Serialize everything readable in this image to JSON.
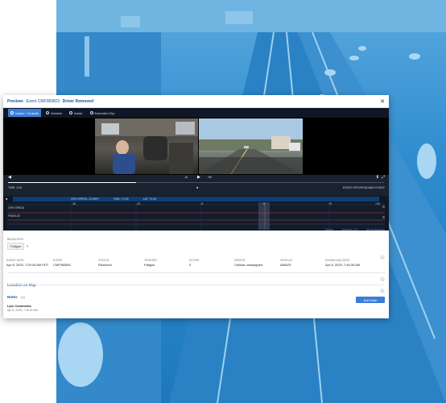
{
  "header": {
    "preview_label": "Preview:",
    "event_id": "Event CMF083801:",
    "event_status": "Driver Removed",
    "close_icon": "close-icon"
  },
  "tabs": [
    {
      "label": "Inside + Outside",
      "active": true
    },
    {
      "label": "Outside",
      "active": false
    },
    {
      "label": "Inside",
      "active": false
    },
    {
      "label": "Extended Clip",
      "active": false
    }
  ],
  "player": {
    "rewind_label": "-5",
    "forward_label": "+5",
    "progress_fraction": 0.34,
    "time_label": "TIME: 4.00",
    "event_time_label": "EVENT INFO/ROADWAY EVENT"
  },
  "telemetry": {
    "speed": "GPS SPEED: 23 MPH",
    "fwd": "FWD: +0.00",
    "lat": "LAT: +0.00",
    "row1": "GPS SPEED",
    "row2": "FWD/LAT",
    "ticks": [
      "-15",
      "-10",
      "-5",
      "0",
      "+5",
      "+10"
    ]
  },
  "actions": {
    "share": "Share",
    "extract_clip": "Extract Clip",
    "more_actions": "More Actions"
  },
  "behaviors": {
    "label": "BEHAVIORS",
    "tag": "Fatigue"
  },
  "info": [
    {
      "label": "EVENT DATE",
      "value": "Apr 8, 2025, 7:29:30 AM PDT"
    },
    {
      "label": "EVENT",
      "value": "CMF083801"
    },
    {
      "label": "STATUS",
      "value": "Resolved"
    },
    {
      "label": "TRIGGER",
      "value": "Fatigue"
    },
    {
      "label": "SCORE",
      "value": "0"
    },
    {
      "label": "DRIVER",
      "value": "Cellular unassigned"
    },
    {
      "label": "VEHICLE",
      "value": "AMAZ9"
    },
    {
      "label": "DOWNLOAD DATE",
      "value": "Apr 8, 2025, 7:46:35 AM"
    }
  ],
  "sections": {
    "location": "Location on Map",
    "notes": "Notes",
    "notes_count": "(1)",
    "add_note": "Add Note"
  },
  "note": {
    "author": "Lytx Comments",
    "date": "Apr 8, 2025, 7:45:02 AM"
  },
  "colors": {
    "accent": "#3c7dd9",
    "title": "#1d4f91",
    "player_bg": "#1a2230"
  }
}
